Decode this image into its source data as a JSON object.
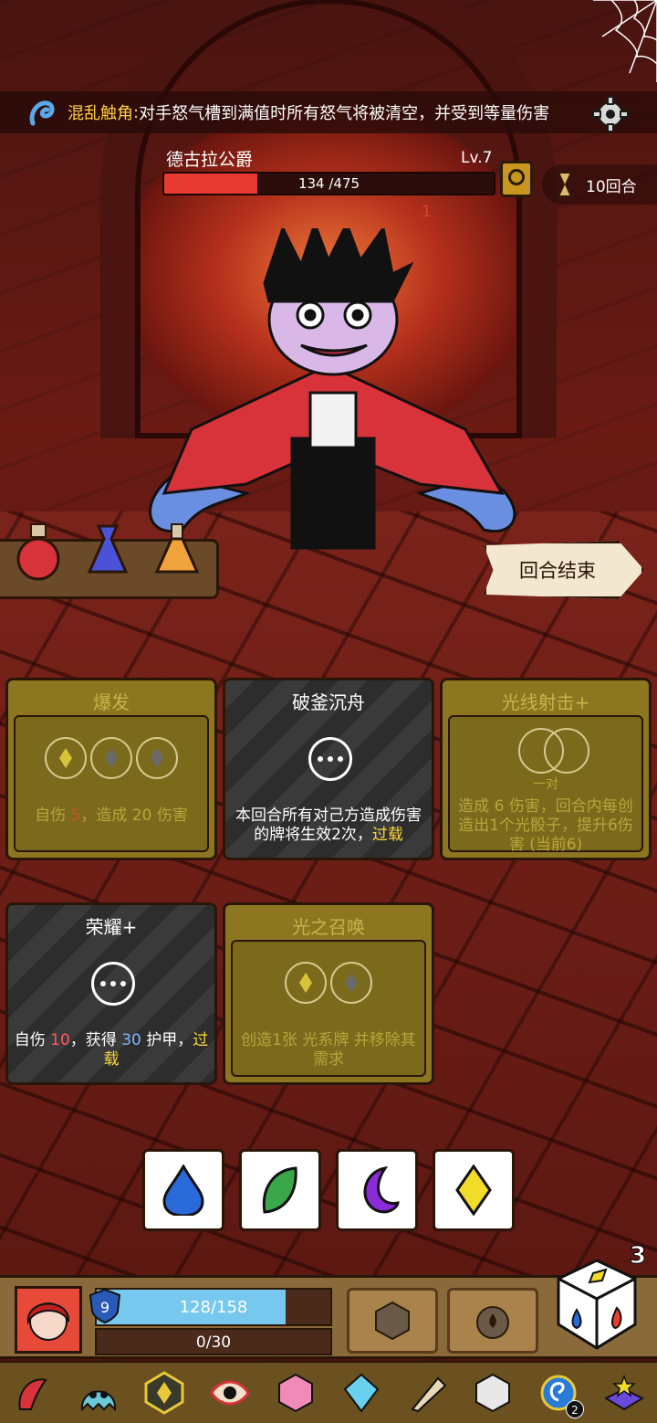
{
  "banner": {
    "ability_name": "混乱触角",
    "separator": ":",
    "ability_desc": "对手怒气槽到满值时所有怒气将被清空，并受到等量伤害"
  },
  "boss": {
    "name": "德古拉公爵",
    "level": "Lv.7",
    "hp_text": "134 /475",
    "hp_fraction": 0.282,
    "damage_float": "1"
  },
  "turns": {
    "label": "10回合"
  },
  "end_turn": {
    "label": "回合结束"
  },
  "cards": [
    {
      "title": "爆发",
      "desc_a": "自伤 ",
      "desc_b": "5",
      "desc_c": "，造成 ",
      "desc_d": "20",
      "desc_e": " 伤害"
    },
    {
      "title": "破釜沉舟",
      "desc_a": "本回合所有对己方造成伤害的牌将生效2次，",
      "keyword": "过载"
    },
    {
      "title": "光线射击+",
      "pair": "一对",
      "desc_a": "造成 ",
      "desc_b": "6",
      "desc_c": " 伤害，回合内每创造出1个光骰子，提升6伤害 ",
      "desc_d": "(当前6)"
    },
    {
      "title": "荣耀+",
      "desc_a": "自伤 ",
      "desc_b": "10",
      "desc_c": "，获得 ",
      "desc_d": "30",
      "desc_e": " 护甲，",
      "keyword": "过载"
    },
    {
      "title": "光之召唤",
      "desc_a": "创造1张 ",
      "desc_b": "光系牌 并移除其需求"
    }
  ],
  "player": {
    "shield": "9",
    "hp_text": "128/158",
    "hp_fraction": 0.81,
    "energy_text": "0/30"
  },
  "dice": {
    "count": "3"
  },
  "relics": {
    "badge": "2"
  },
  "colors": {
    "hp_red": "#e83a32",
    "player_hp_blue": "#76c8ef",
    "keyword_yellow": "#ffd93a"
  }
}
